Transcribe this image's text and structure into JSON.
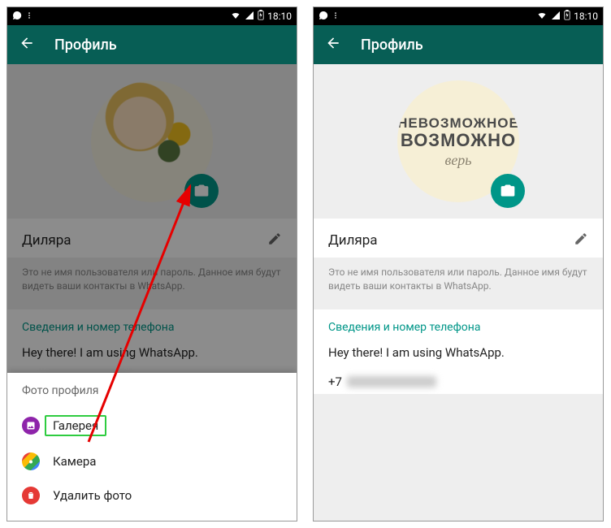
{
  "statusbar": {
    "time": "18:10"
  },
  "appbar": {
    "title": "Профиль"
  },
  "avatar": {
    "moto_line1": "НЕВОЗМОЖНОЕ",
    "moto_line2": "ВОЗМОЖНО",
    "moto_line3": "верь"
  },
  "profile": {
    "name": "Диляра",
    "hint": "Это не имя пользователя или пароль. Данное имя будут видеть ваши контакты в WhatsApp.",
    "section_title": "Сведения и номер телефона",
    "status": "Hey there! I am using WhatsApp.",
    "phone_prefix": "+7"
  },
  "bottomsheet": {
    "title": "Фото профиля",
    "gallery": "Галерея",
    "camera": "Камера",
    "remove": "Удалить фото"
  }
}
